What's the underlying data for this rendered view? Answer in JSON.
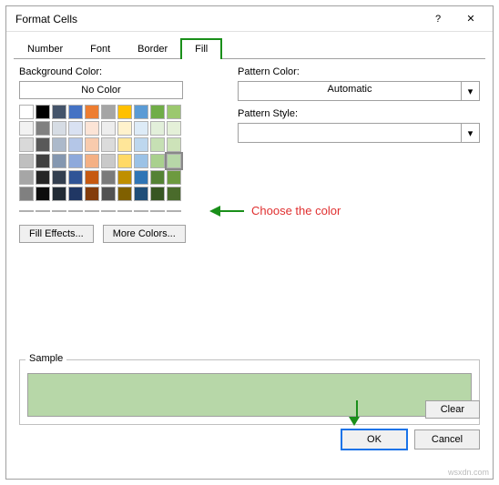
{
  "dialog": {
    "title": "Format Cells",
    "help_icon": "?",
    "close_icon": "✕"
  },
  "tabs": {
    "number": "Number",
    "font": "Font",
    "border": "Border",
    "fill": "Fill"
  },
  "fill": {
    "bg_color_label": "Background Color:",
    "no_color": "No Color",
    "fill_effects": "Fill Effects...",
    "more_colors": "More Colors...",
    "pattern_color_label": "Pattern Color:",
    "pattern_color_value": "Automatic",
    "pattern_style_label": "Pattern Style:",
    "pattern_style_value": ""
  },
  "annotation": {
    "choose": "Choose the color"
  },
  "sample": {
    "label": "Sample",
    "color": "#b7d7a8"
  },
  "buttons": {
    "clear": "Clear",
    "ok": "OK",
    "cancel": "Cancel"
  },
  "colors": {
    "row1": [
      "#ffffff",
      "#000000",
      "#44546a",
      "#4472c4",
      "#ed7d31",
      "#a5a5a5",
      "#ffc000",
      "#5b9bd5",
      "#70ad47",
      "#9bc86e"
    ],
    "row2": [
      "#f2f2f2",
      "#808080",
      "#d6dce4",
      "#d9e1f2",
      "#fce4d6",
      "#ededed",
      "#fff2cc",
      "#ddebf7",
      "#e2efda",
      "#e4f0d8"
    ],
    "row3": [
      "#d9d9d9",
      "#595959",
      "#acb9ca",
      "#b4c6e7",
      "#f8cbad",
      "#dbdbdb",
      "#ffe699",
      "#bdd7ee",
      "#c6e0b4",
      "#cde3b9"
    ],
    "row4": [
      "#bfbfbf",
      "#404040",
      "#8497b0",
      "#8ea9db",
      "#f4b084",
      "#c9c9c9",
      "#ffd966",
      "#9bc2e6",
      "#a9d08e",
      "#b7d7a8"
    ],
    "row5": [
      "#a6a6a6",
      "#262626",
      "#333f4f",
      "#305496",
      "#c65911",
      "#7b7b7b",
      "#bf8f00",
      "#2f75b5",
      "#548235",
      "#6d9a3f"
    ],
    "row6": [
      "#808080",
      "#0d0d0d",
      "#222b35",
      "#203764",
      "#833c0c",
      "#525252",
      "#806000",
      "#1f4e78",
      "#375623",
      "#4a6b2b"
    ],
    "std": [
      "#c00000",
      "#ff0000",
      "#ffc000",
      "#ffff00",
      "#92d050",
      "#00b050",
      "#00b0f0",
      "#0070c0",
      "#002060",
      "#7030a0"
    ]
  },
  "watermark": "wsxdn.com"
}
